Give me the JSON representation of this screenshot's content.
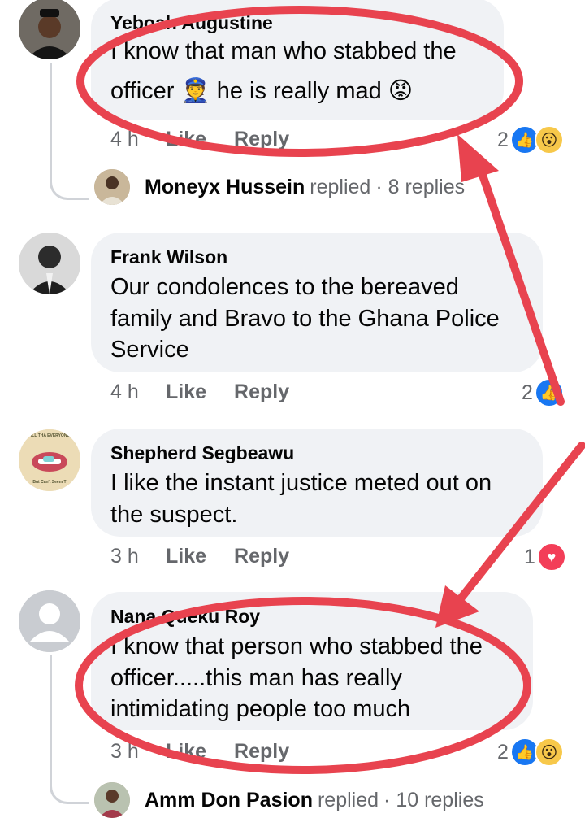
{
  "comments": [
    {
      "author": "Yeboah Augustine",
      "text_l1": "I know that man who stabbed the",
      "text_l2_a": "officer",
      "text_l2_b": "he is really mad",
      "time": "4 h",
      "like": "Like",
      "reply": "Reply",
      "reaction_count": "2",
      "reply_preview": {
        "name": "Moneyx Hussein",
        "action": "replied",
        "count": "· 8 replies"
      }
    },
    {
      "author": "Frank Wilson",
      "text_l1": "Our condolences to the bereaved",
      "text_l2": "family and Bravo to the Ghana Police",
      "text_l3": "Service",
      "time": "4 h",
      "like": "Like",
      "reply": "Reply",
      "reaction_count": "2"
    },
    {
      "author": "Shepherd Segbeawu",
      "text_l1": "I like the instant justice meted out on",
      "text_l2": "the suspect.",
      "time": "3 h",
      "like": "Like",
      "reply": "Reply",
      "reaction_count": "1"
    },
    {
      "author": "Nana Queku Roy",
      "text_l1": "I know that person who stabbed the",
      "text_l2": "officer.....this man has really",
      "text_l3": "intimidating people too much",
      "time": "3 h",
      "like": "Like",
      "reply": "Reply",
      "reaction_count": "2",
      "reply_preview": {
        "name": "Amm Don Pasion",
        "action": "replied",
        "count": "· 10 replies"
      }
    }
  ],
  "emoji": {
    "officer": "👮",
    "angry": "😡"
  },
  "badge_text": {
    "top": "THE PILL THA EVERYONE WAN",
    "bottom": "But Can't Seem T"
  },
  "colors": {
    "bubble": "#f0f2f5",
    "annotation": "#e8434f",
    "like_blue": "#1877f2",
    "love_red": "#f33e58"
  }
}
